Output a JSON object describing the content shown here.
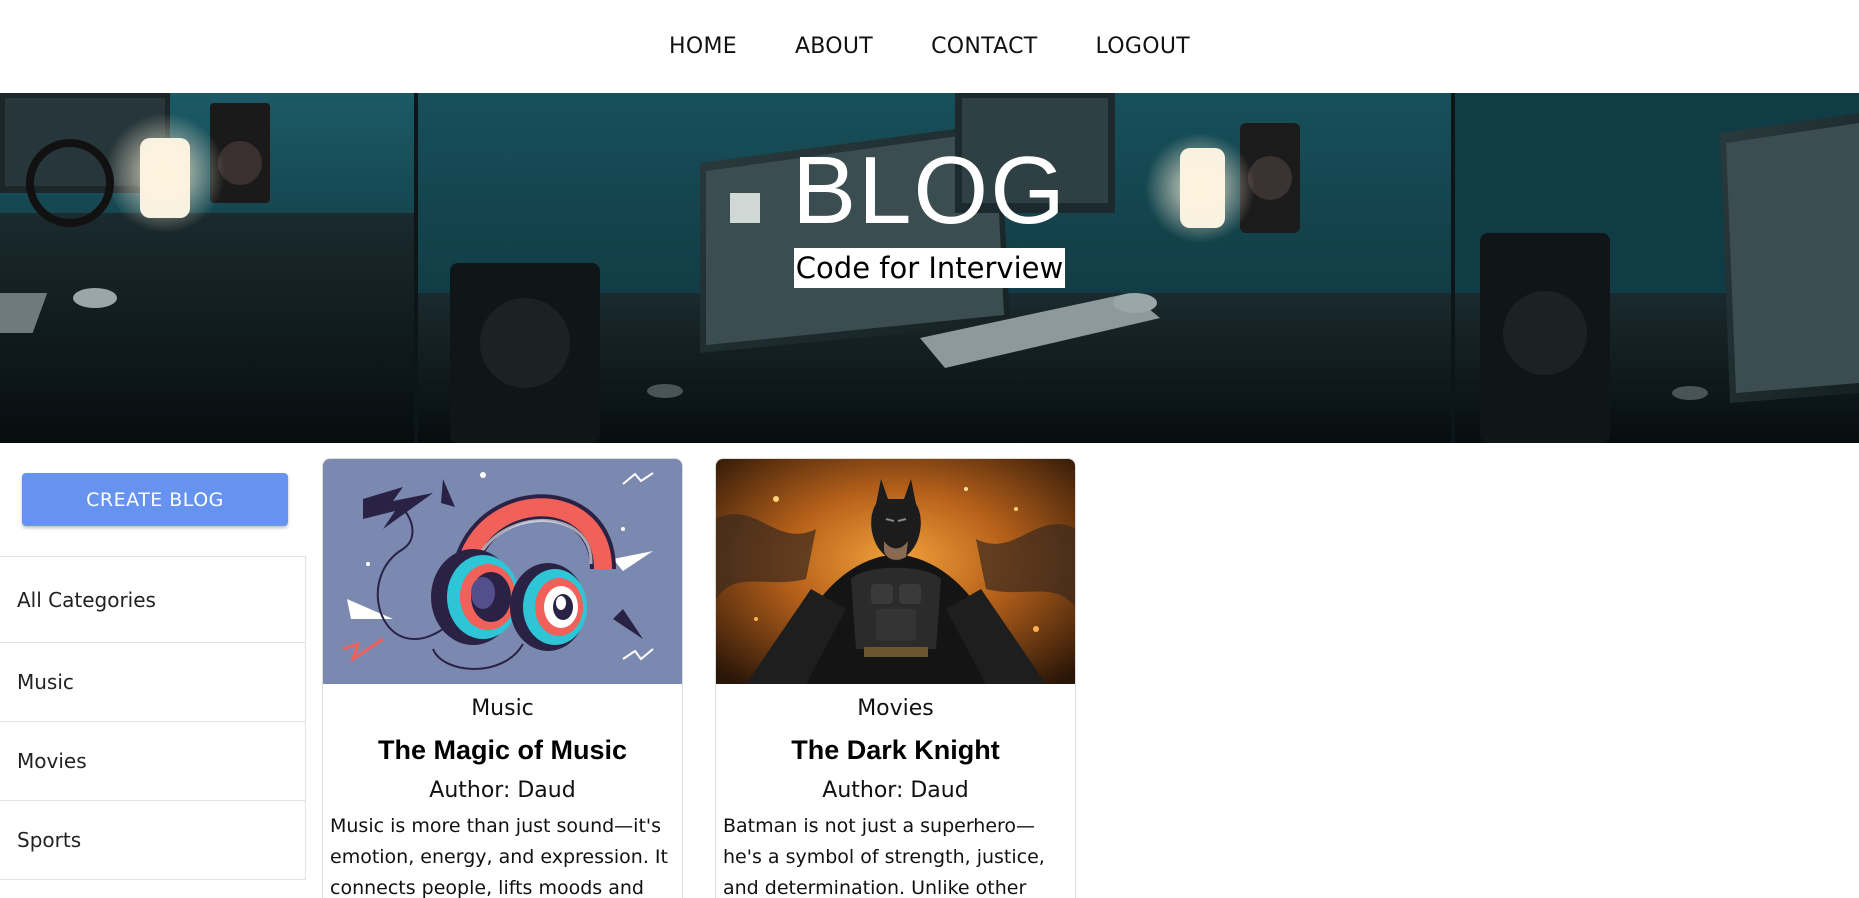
{
  "nav": {
    "items": [
      "HOME",
      "ABOUT",
      "CONTACT",
      "LOGOUT"
    ]
  },
  "hero": {
    "title": "BLOG",
    "subtitle": "Code for Interview"
  },
  "sidebar": {
    "create_button": "CREATE BLOG",
    "categories": [
      "All Categories",
      "Music",
      "Movies",
      "Sports"
    ]
  },
  "posts": [
    {
      "category": "Music",
      "title": "The Magic of Music",
      "author": "Author: Daud",
      "excerpt": "Music is more than just sound—it's emotion, energy, and expression. It connects people, lifts moods and",
      "image_icon": "headphones-image"
    },
    {
      "category": "Movies",
      "title": "The Dark Knight",
      "author": "Author: Daud",
      "excerpt": "Batman is not just a superhero—he's a symbol of strength, justice, and determination. Unlike other heroes",
      "image_icon": "batman-image"
    }
  ],
  "colors": {
    "primary_button": "#6593ef",
    "music_card_bg": "#7b88b0",
    "accent_red": "#f2605a"
  }
}
